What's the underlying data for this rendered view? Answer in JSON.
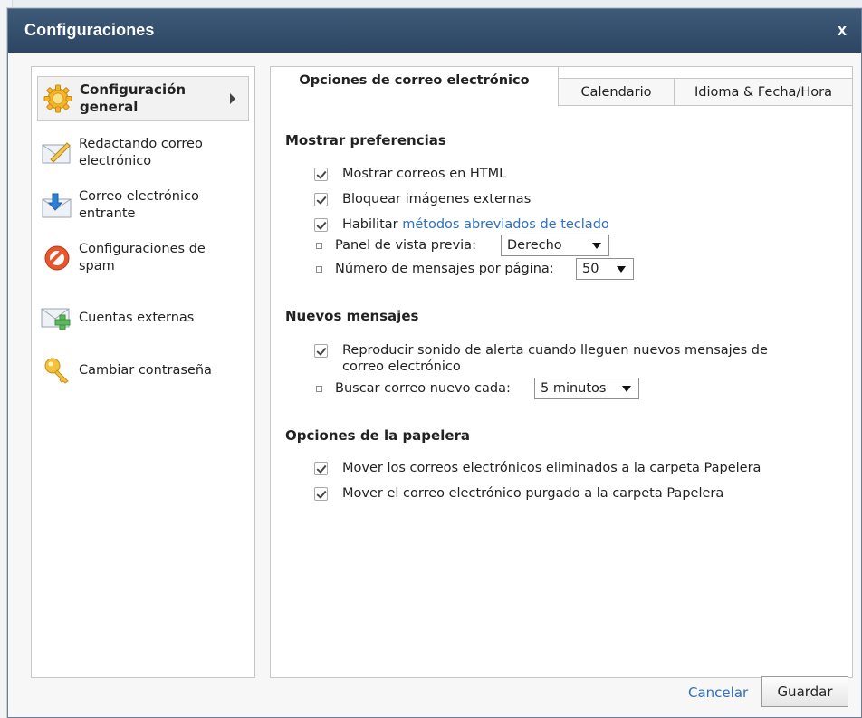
{
  "window": {
    "title": "Configuraciones",
    "close_label": "x"
  },
  "sidebar": {
    "items": [
      {
        "label": "Configuración general",
        "icon": "gear-icon",
        "active": true
      },
      {
        "label": "Redactando correo electrónico",
        "icon": "compose-envelope-icon"
      },
      {
        "label": "Correo electrónico entrante",
        "icon": "incoming-mail-icon"
      },
      {
        "label": "Configuraciones de spam",
        "icon": "spam-block-icon"
      },
      {
        "label": "Cuentas externas",
        "icon": "add-account-envelope-icon"
      },
      {
        "label": "Cambiar contraseña",
        "icon": "key-icon"
      }
    ]
  },
  "tabs": [
    {
      "label": "Opciones de correo electrónico",
      "active": true
    },
    {
      "label": "Calendario"
    },
    {
      "label": "Idioma & Fecha/Hora"
    }
  ],
  "sections": {
    "display": {
      "title": "Mostrar preferencias",
      "show_html": "Mostrar correos en HTML",
      "block_images": "Bloquear imágenes externas",
      "enable_prefix": "Habilitar",
      "enable_link": "métodos abreviados de teclado",
      "preview_label": "Panel de vista previa:",
      "preview_value": "Derecho",
      "per_page_label": "Número de mensajes por página:",
      "per_page_value": "50"
    },
    "new_messages": {
      "title": "Nuevos mensajes",
      "alert_sound": "Reproducir sonido de alerta cuando lleguen nuevos mensajes de correo electrónico",
      "check_label": "Buscar correo nuevo cada:",
      "check_value": "5 minutos"
    },
    "trash": {
      "title": "Opciones de la papelera",
      "move_deleted": "Mover los correos electrónicos eliminados a la carpeta Papelera",
      "move_purged": "Mover el correo electrónico purgado a la carpeta Papelera"
    }
  },
  "footer": {
    "cancel_label": "Cancelar",
    "save_label": "Guardar"
  },
  "colors": {
    "titlebar": "#34506e",
    "link": "#2f6fbf"
  }
}
